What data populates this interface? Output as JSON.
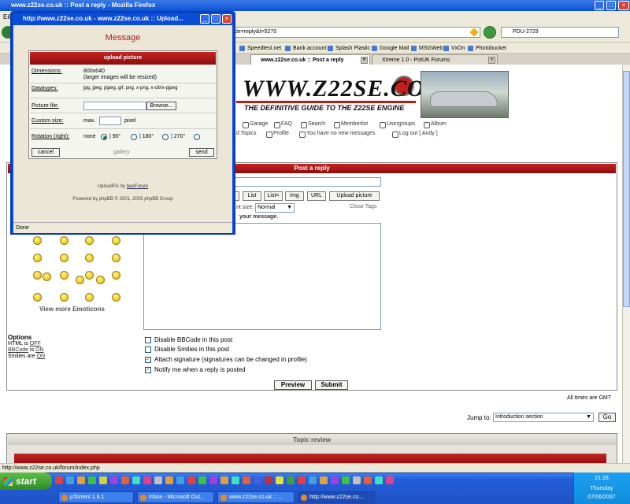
{
  "browser": {
    "window_title": "www.z22se.co.uk :: Post a reply - Mozilla Firefox",
    "menu_first": "Eile",
    "url_fragment": "ode=reply&t=5270",
    "search_value": "PDU-2729",
    "status_text": "http://www.z22se.co.uk/forum/index.php"
  },
  "bookmarks": [
    "Speedtest.net",
    "Bank account",
    "Splash Plastic",
    "Google Mail",
    "MSGWeb",
    "VxOn",
    "Photobucket"
  ],
  "tabs": [
    "www.z22se.co.uk :: Post a reply",
    "Xtreme 1.0 - PotUK Forums"
  ],
  "site": {
    "logo": "WWW.Z22SE.CO.UK",
    "tagline": "THE DEFINITIVE GUIDE TO THE Z22SE ENGINE",
    "nav": [
      "Garage",
      "FAQ",
      "Search",
      "Memberlist",
      "Usergroups",
      "Album"
    ],
    "nav2": [
      "d Topics",
      "Profile",
      "You have no new messages",
      "Log out [ Andy ]"
    ]
  },
  "post": {
    "header": "Post a reply",
    "toolbar": [
      "List",
      "List=",
      "Img",
      "URL",
      "Upload picture"
    ],
    "font_label": "nt size:",
    "font_size": "Normal",
    "close_tags": "Close Tags",
    "msg_label": "your message.",
    "more_emoticons": "View more Emoticons",
    "options_title": "Options",
    "html_label": "HTML is",
    "html_value": "OFF",
    "bbcode_label": "BBCode",
    "bbcode_is": "is",
    "bbcode_value": "ON",
    "smilies_label": "Smilies are",
    "smilies_value": "ON",
    "checkboxes": [
      {
        "label": "Disable BBCode in this post",
        "checked": false
      },
      {
        "label": "Disable Smilies in this post",
        "checked": false
      },
      {
        "label": "Attach signature (signatures can be changed in profile)",
        "checked": true
      },
      {
        "label": "Notify me when a reply is posted",
        "checked": true
      }
    ],
    "preview": "Preview",
    "submit": "Submit",
    "all_times": "All times are GMT",
    "jump_to": "Jump to:",
    "jump_value": "Introduction section",
    "go": "Go",
    "topic_review": "Topic review"
  },
  "popup": {
    "title": "http://www.z22se.co.uk - www.z22se.co.uk :: Upload...",
    "heading": "Message",
    "box_title": "upload picture",
    "dimensions_label": "Dimensions:",
    "dimensions_value": "800x640",
    "dimensions_note": "(larger images will be resized)",
    "datatypes_label": "Datatypes:",
    "datatypes_value": "jpg, jpeg, pjpeg, gif, png, x-png, x-citrix-pjpeg",
    "picture_label": "Picture file:",
    "browse": "Browse...",
    "custom_label": "Custom size:",
    "max": "max.",
    "pixel": "pixel",
    "rotation_label": "Rotation (right):",
    "rot_none": "none",
    "rot_90": "| 90°",
    "rot_180": "| 180°",
    "rot_270": "| 270°",
    "cancel": "cancel",
    "gallery": "gallery",
    "send": "send",
    "uploadpic_by": "UploadPic by",
    "beeforum": "beeForum",
    "powered": "Powered by phpBB © 2001, 2005 phpBB Group",
    "status": "Done"
  },
  "taskbar": {
    "start": "start",
    "buttons": [
      "µTorrent 1.6.1",
      "Inbox - Microsoft Out...",
      "www.z22se.co.uk :: ...",
      "http://www.z22se.co...."
    ],
    "time": "21:33",
    "day": "Thursday",
    "date": "07/06/2007"
  }
}
